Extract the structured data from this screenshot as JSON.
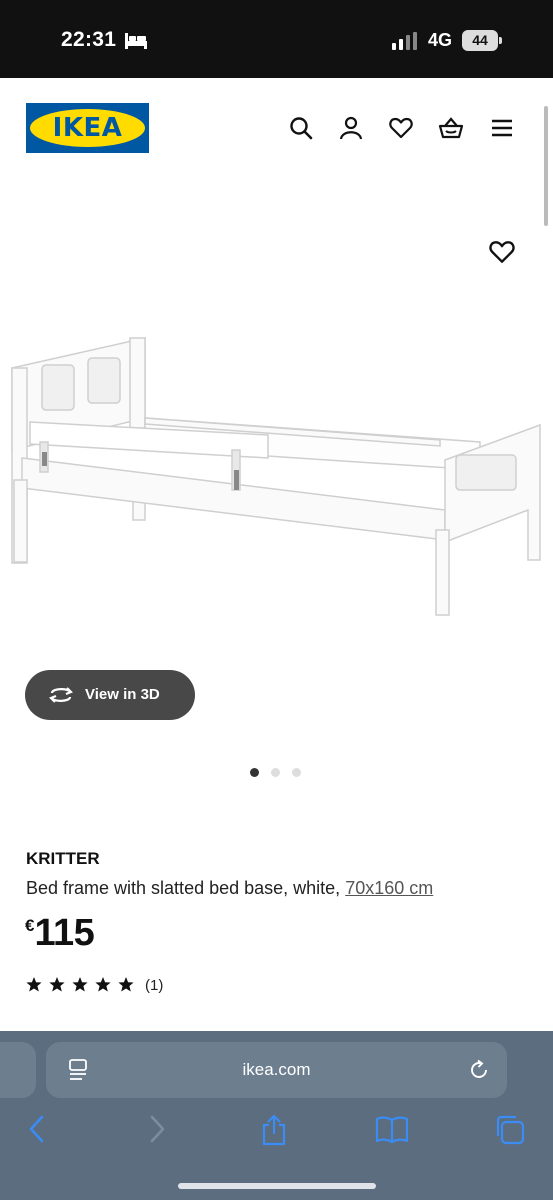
{
  "status": {
    "time": "22:31",
    "network": "4G",
    "battery": "44"
  },
  "brand": {
    "logo_text": "IKEA",
    "blue": "#0058a3",
    "yellow": "#ffdb00"
  },
  "header": {
    "icons": [
      "search-icon",
      "account-icon",
      "heart-icon",
      "basket-icon",
      "menu-icon"
    ]
  },
  "product": {
    "view3d_label": "View in 3D",
    "name": "KRITTER",
    "description": "Bed frame with slatted bed base, white, ",
    "size": "70x160 cm",
    "currency": "€",
    "price": "115",
    "rating": 5,
    "rating_count": "(1)",
    "gallery_pages": 3,
    "gallery_active": 1
  },
  "browser": {
    "url": "ikea.com",
    "toolbar_icons": [
      "back-icon",
      "forward-icon",
      "share-icon",
      "bookmarks-icon",
      "tabs-icon"
    ]
  }
}
